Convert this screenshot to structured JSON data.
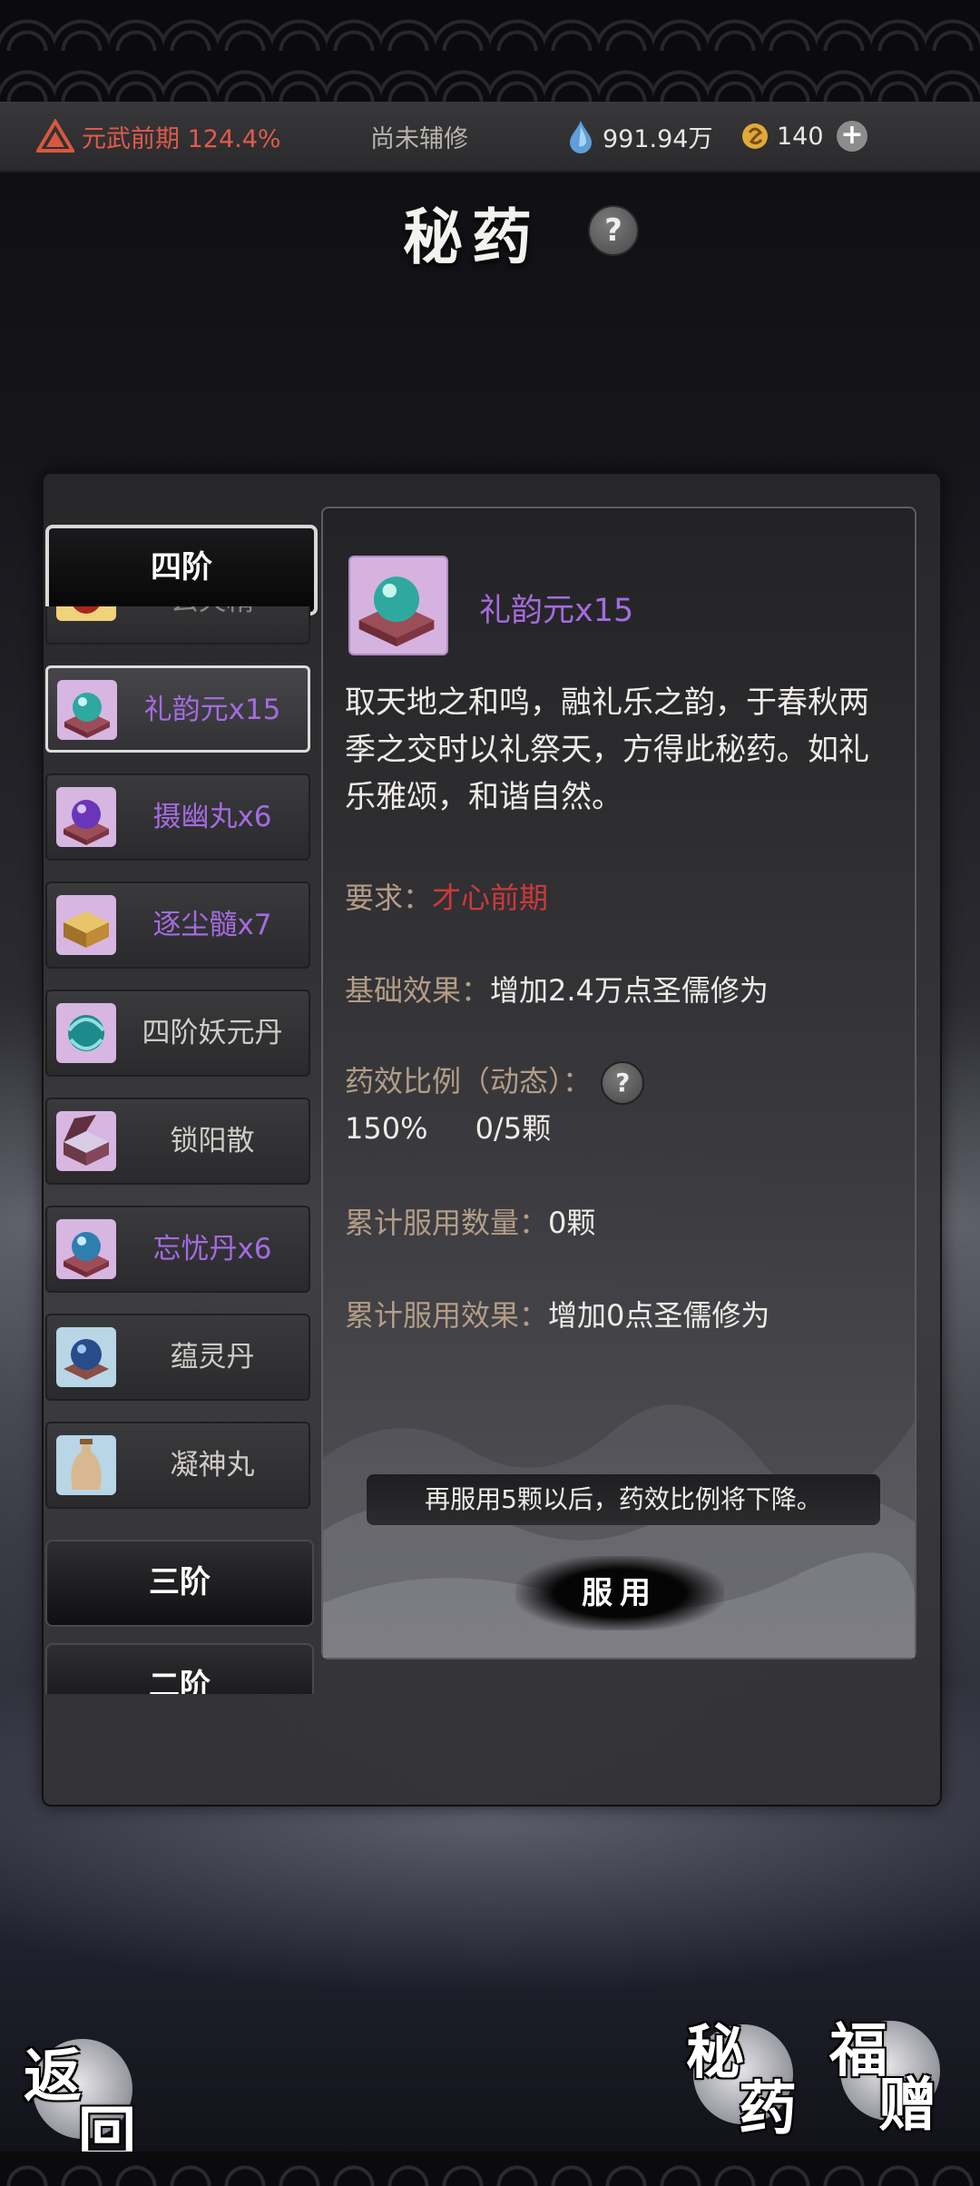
{
  "status_bar": {
    "realm_text": "元武前期 124.4%",
    "assist_text": "尚未辅修",
    "spirit_stones": "991.94万",
    "coins": "140"
  },
  "page": {
    "title": "秘药"
  },
  "tiers": {
    "tier4": "四阶",
    "tier3": "三阶",
    "tier2": "二阶"
  },
  "items": [
    {
      "label": "玄火精",
      "style": "dim",
      "icon": "red-gourd-icon"
    },
    {
      "label": "礼韵元x15",
      "style": "purple",
      "icon": "teal-orb-icon"
    },
    {
      "label": "摄幽丸x6",
      "style": "purple",
      "icon": "purple-orb-icon"
    },
    {
      "label": "逐尘髓x7",
      "style": "purple",
      "icon": "gold-box-icon"
    },
    {
      "label": "四阶妖元丹",
      "style": "normal",
      "icon": "swirl-orb-icon"
    },
    {
      "label": "锁阳散",
      "style": "normal",
      "icon": "open-box-icon"
    },
    {
      "label": "忘忧丹x6",
      "style": "purple",
      "icon": "teal-orb-icon"
    },
    {
      "label": "蕴灵丹",
      "style": "normal",
      "icon": "blue-orb-icon"
    },
    {
      "label": "凝神丸",
      "style": "normal",
      "icon": "vase-icon"
    }
  ],
  "detail": {
    "name": "礼韵元x15",
    "description": "取天地之和鸣，融礼乐之韵，于春秋两季之交时以礼祭天，方得此秘药。如礼乐雅颂，和谐自然。",
    "requirement_label": "要求：",
    "requirement_value": "才心前期",
    "base_effect_label": "基础效果：",
    "base_effect_value": "增加2.4万点圣儒修为",
    "ratio_label": "药效比例（动态）：",
    "ratio_percent": "150%",
    "ratio_count": "0/5颗",
    "total_count_label": "累计服用数量：",
    "total_count_value": "0颗",
    "total_effect_label": "累计服用效果：",
    "total_effect_value": "增加0点圣儒修为",
    "notice": "再服用5颗以后，药效比例将下降。",
    "take_button": "服用"
  },
  "bottom_nav": {
    "back_top": "返",
    "back_bottom": "回",
    "elixir_top": "秘",
    "elixir_bottom": "药",
    "gift_top": "福",
    "gift_bottom": "赠"
  },
  "colors": {
    "realm": "#e05a4a",
    "purple_item": "#a56be0",
    "requirement": "#cc3a3a",
    "label_tan": "#b39d86"
  }
}
